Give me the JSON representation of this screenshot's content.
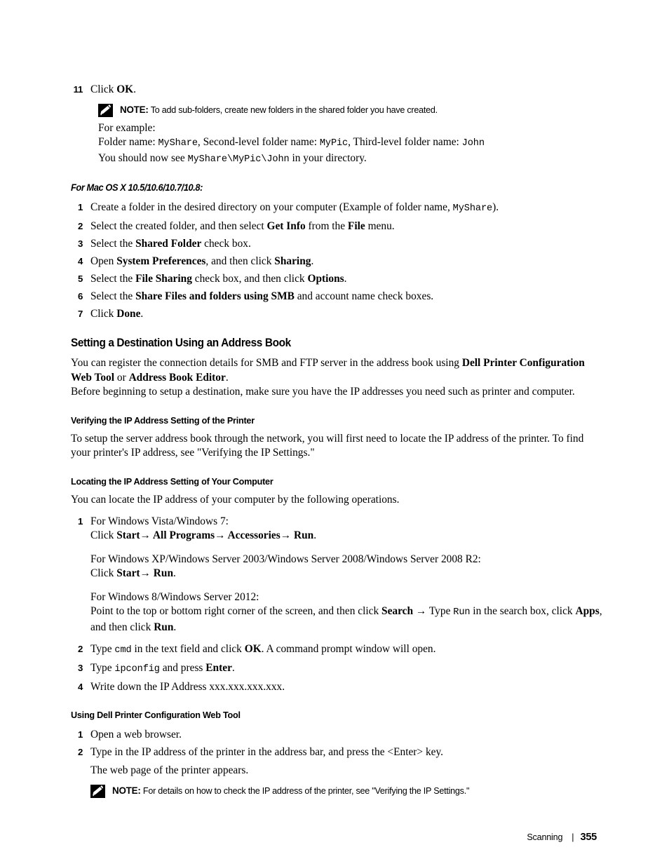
{
  "page": {
    "footer_section": "Scanning",
    "footer_separator": "|",
    "page_number": "355",
    "note_icon_name": "note-pencil-icon"
  },
  "step11": {
    "number": "11",
    "text_prefix": "Click ",
    "text_bold": "OK",
    "text_suffix": "."
  },
  "note1": {
    "label": "NOTE:",
    "text": "To add sub-folders, create new folders in the shared folder you have created."
  },
  "example": {
    "line1": "For example:",
    "line2_a": "Folder name: ",
    "line2_code1": "MyShare",
    "line2_b": ", Second-level folder name: ",
    "line2_code2": "MyPic",
    "line2_c": ", Third-level folder name: ",
    "line2_code3": "John",
    "line3_a": "You should now see ",
    "line3_code": "MyShare\\MyPic\\John",
    "line3_b": " in your directory."
  },
  "mac_section": {
    "heading": "For Mac OS X 10.5/10.6/10.7/10.8:",
    "steps": [
      {
        "number": "1",
        "a": "Create a folder in the desired directory on your computer (Example of folder name, ",
        "code": "MyShare",
        "b": ")."
      },
      {
        "number": "2",
        "a": "Select the created folder, and then select ",
        "bold1": "Get Info",
        "b": " from the ",
        "bold2": "File",
        "c": " menu."
      },
      {
        "number": "3",
        "a": "Select the ",
        "bold1": "Shared Folder",
        "b": " check box."
      },
      {
        "number": "4",
        "a": "Open ",
        "bold1": "System Preferences",
        "b": ", and then click ",
        "bold2": "Sharing",
        "c": "."
      },
      {
        "number": "5",
        "a": "Select the ",
        "bold1": "File Sharing",
        "b": " check box, and then click ",
        "bold2": "Options",
        "c": "."
      },
      {
        "number": "6",
        "a": "Select the ",
        "bold1": "Share Files and folders using SMB",
        "b": " and account name check boxes."
      },
      {
        "number": "7",
        "a": "Click ",
        "bold1": "Done",
        "b": "."
      }
    ]
  },
  "address_book": {
    "heading": "Setting a Destination Using an Address Book",
    "para1_a": "You can register the connection details for SMB and FTP server in the address book using ",
    "para1_bold1": "Dell Printer Configuration Web Tool",
    "para1_b": " or ",
    "para1_bold2": "Address Book Editor",
    "para1_c": ".",
    "para2": "Before beginning to setup a destination, make sure you have the IP addresses you need such as printer and computer."
  },
  "verify_ip": {
    "heading": "Verifying the IP Address Setting of the Printer",
    "para": "To setup the server address book through the network, you will first need to locate the IP address of the printer. To find your printer's IP address, see \"Verifying the IP Settings.\""
  },
  "locate_ip": {
    "heading": "Locating the IP Address Setting of Your Computer",
    "intro": "You can locate the IP address of your computer by the following operations.",
    "step1": {
      "number": "1",
      "vista_line": "For Windows Vista/Windows 7:",
      "vista_click_a": "Click ",
      "vista_bold1": "Start",
      "vista_arrow1": "→",
      "vista_bold2": " All Programs",
      "vista_arrow2": "→",
      "vista_bold3": " Accessories",
      "vista_arrow3": "→",
      "vista_bold4": " Run",
      "vista_end": ".",
      "xp_line": "For Windows XP/Windows Server 2003/Windows Server 2008/Windows Server 2008 R2:",
      "xp_click_a": "Click ",
      "xp_bold1": "Start",
      "xp_arrow1": "→",
      "xp_bold2": " Run",
      "xp_end": ".",
      "win8_line": "For Windows 8/Windows Server 2012:",
      "win8_a": "Point to the top or bottom right corner of the screen, and then click ",
      "win8_bold1": "Search",
      "win8_arrow": " → ",
      "win8_b": "Type ",
      "win8_code": "Run",
      "win8_c": " in the search box, click ",
      "win8_bold2": "Apps",
      "win8_d": ", and then click ",
      "win8_bold3": "Run",
      "win8_e": "."
    },
    "step2": {
      "number": "2",
      "a": "Type ",
      "code": "cmd",
      "b": " in the text field and click ",
      "bold1": "OK",
      "c": ". A command prompt window will open."
    },
    "step3": {
      "number": "3",
      "a": "Type ",
      "code": "ipconfig",
      "b": " and press ",
      "bold1": "Enter",
      "c": "."
    },
    "step4": {
      "number": "4",
      "a": "Write down the IP Address xxx.xxx.xxx.xxx."
    }
  },
  "web_tool": {
    "heading": "Using Dell Printer Configuration Web Tool",
    "step1": {
      "number": "1",
      "a": "Open a web browser."
    },
    "step2": {
      "number": "2",
      "a": "Type in the IP address of the printer in the address bar, and press the <Enter> key.",
      "sub": "The web page of the printer appears."
    },
    "note": {
      "label": "NOTE:",
      "text": "For details on how to check the IP address of the printer, see \"Verifying the IP Settings.\""
    }
  }
}
